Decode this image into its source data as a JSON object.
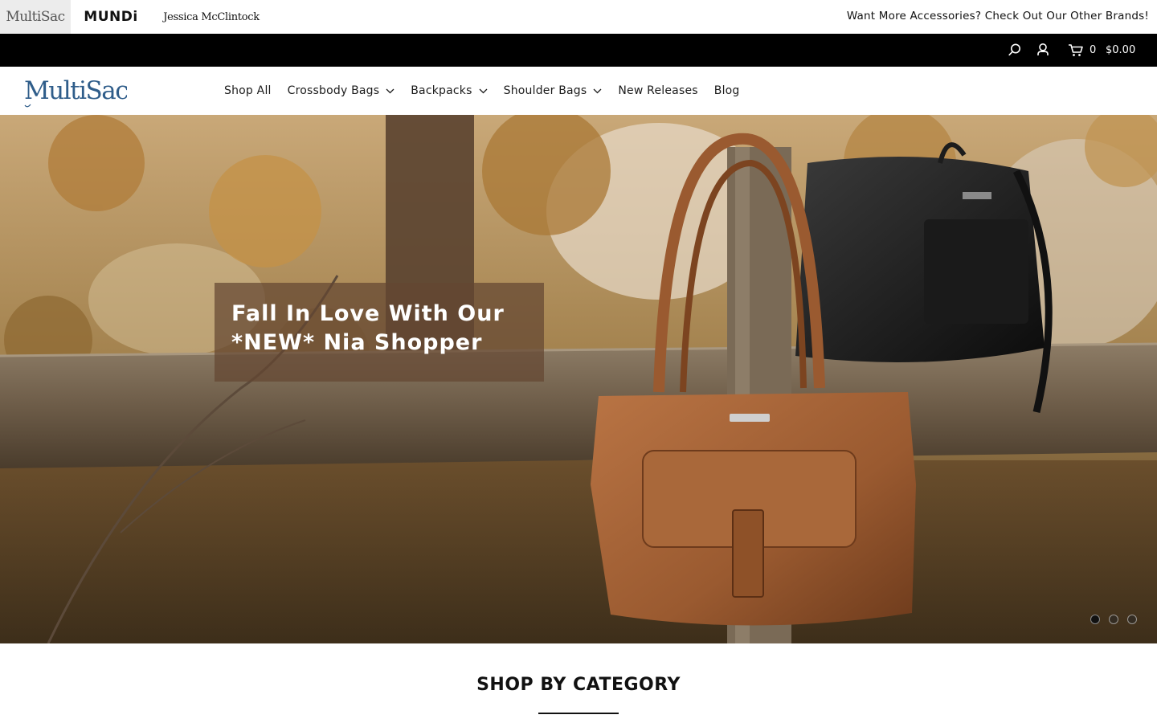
{
  "brand_bar": {
    "brands": [
      {
        "name": "MultiSac",
        "active": true
      },
      {
        "name": "MUNDi",
        "active": false
      },
      {
        "name": "Jessica McClintock",
        "active": false
      }
    ],
    "promo_text": "Want More Accessories? Check Out Our Other Brands!"
  },
  "utility_bar": {
    "icons": [
      "search-icon",
      "user-icon",
      "cart-icon"
    ],
    "cart_count": "0",
    "cart_total": "$0.00"
  },
  "logo": {
    "text": "MultiSac"
  },
  "nav": {
    "items": [
      {
        "label": "Shop All",
        "dropdown": false
      },
      {
        "label": "Crossbody Bags",
        "dropdown": true
      },
      {
        "label": "Backpacks",
        "dropdown": true
      },
      {
        "label": "Shoulder Bags",
        "dropdown": true
      },
      {
        "label": "New Releases",
        "dropdown": false
      },
      {
        "label": "Blog",
        "dropdown": false
      }
    ]
  },
  "hero": {
    "caption_line1": "Fall In Love With Our",
    "caption_line2": "*NEW* Nia Shopper",
    "slides": 3,
    "active_slide": 1
  },
  "category": {
    "heading": "SHOP BY CATEGORY"
  },
  "colors": {
    "utility_bar_bg": "#000000",
    "logo_blue": "#2f5d8a",
    "caption_bg": "#644632"
  }
}
